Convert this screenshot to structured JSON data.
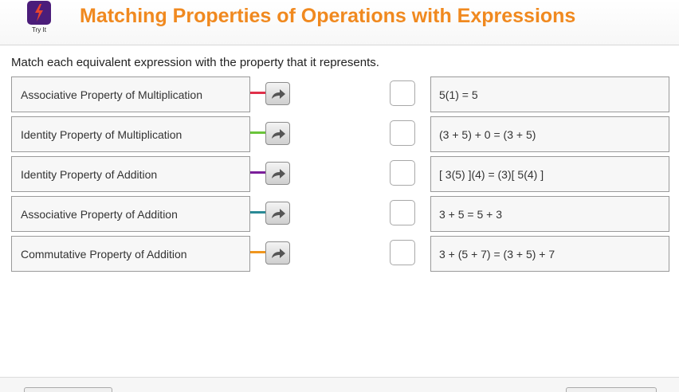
{
  "header": {
    "logo_label": "Try It",
    "title": "Matching Properties of Operations with Expressions",
    "brand_color": "#4b1d7a",
    "title_color": "#f0891f"
  },
  "instructions": "Match each equivalent expression with the property that it represents.",
  "properties": [
    {
      "label": "Associative Property of Multiplication",
      "connector_color": "#e0304a"
    },
    {
      "label": "Identity Property of Multiplication",
      "connector_color": "#6ac43a"
    },
    {
      "label": "Identity Property of Addition",
      "connector_color": "#7a1e9a"
    },
    {
      "label": "Associative Property of Addition",
      "connector_color": "#2a8a96"
    },
    {
      "label": "Commutative Property of Addition",
      "connector_color": "#f0961e"
    }
  ],
  "expressions": [
    {
      "label": "5(1) = 5"
    },
    {
      "label": "(3 + 5) + 0 = (3 + 5)"
    },
    {
      "label": "[ 3(5) ](4) = (3)[ 5(4) ]"
    },
    {
      "label": "3 + 5 = 5 + 3"
    },
    {
      "label": "3 + (5 + 7) = (3 + 5) + 7"
    }
  ],
  "icons": {
    "logo": "lightning-bolt-icon",
    "connect_button": "curved-arrow-icon"
  }
}
